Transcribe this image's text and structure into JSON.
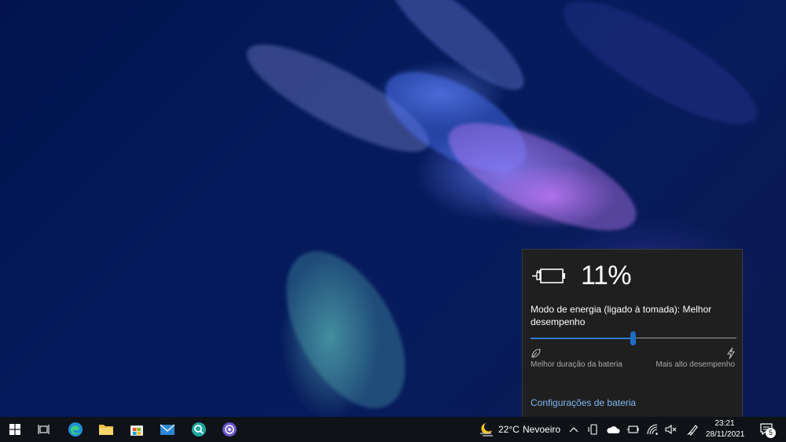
{
  "battery_flyout": {
    "percent": "11%",
    "power_mode_text": "Modo de energia (ligado à tomada): Melhor desempenho",
    "slider_level": 0.5,
    "label_left": "Melhor duração da bateria",
    "label_right": "Mais alto desempenho",
    "settings_link": "Configurações de bateria"
  },
  "taskbar": {
    "apps": [
      "start-icon",
      "task-view-icon",
      "edge-icon",
      "file-explorer-icon",
      "store-icon",
      "mail-icon",
      "search-app-icon",
      "screen-recorder-icon"
    ],
    "weather_temp": "22°C",
    "weather_desc": "Nevoeiro",
    "time": "23:21",
    "date": "28/11/2021",
    "notification_count": "5"
  },
  "colors": {
    "accent": "#1f6cc8",
    "link": "#7fb7f3",
    "flyout_bg": "#1f1f1f",
    "taskbar_bg": "#0f1216"
  }
}
